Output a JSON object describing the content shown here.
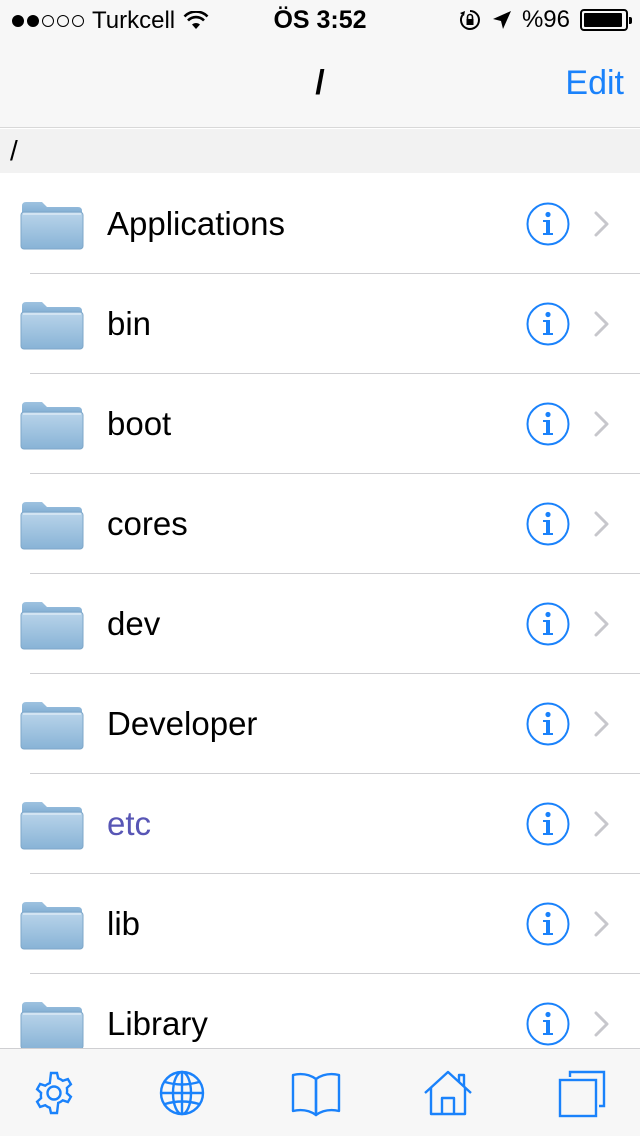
{
  "status_bar": {
    "carrier": "Turkcell",
    "signal_bars_filled": 2,
    "signal_bars_total": 5,
    "time": "ÖS 3:52",
    "battery_label": "%96",
    "battery_level": 0.96
  },
  "nav": {
    "title": "/",
    "edit_label": "Edit"
  },
  "path": "/",
  "items": [
    {
      "name": "Applications",
      "visited": false
    },
    {
      "name": "bin",
      "visited": false
    },
    {
      "name": "boot",
      "visited": false
    },
    {
      "name": "cores",
      "visited": false
    },
    {
      "name": "dev",
      "visited": false
    },
    {
      "name": "Developer",
      "visited": false
    },
    {
      "name": "etc",
      "visited": true
    },
    {
      "name": "lib",
      "visited": false
    },
    {
      "name": "Library",
      "visited": false
    }
  ],
  "tabs": [
    {
      "id": "settings",
      "icon": "gear-icon"
    },
    {
      "id": "web",
      "icon": "globe-icon"
    },
    {
      "id": "bookmarks",
      "icon": "book-icon"
    },
    {
      "id": "home",
      "icon": "house-icon"
    },
    {
      "id": "windows",
      "icon": "windows-icon"
    }
  ],
  "colors": {
    "accent": "#1a82fb",
    "visited_text": "#5856b5"
  }
}
